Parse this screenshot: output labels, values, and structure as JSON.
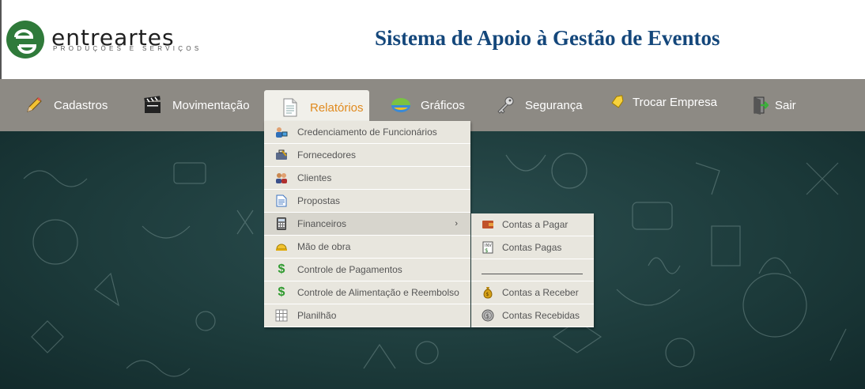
{
  "brand": {
    "name": "entreartes",
    "tagline": "PRODUÇÕES E SERVIÇOS",
    "color": "#3a7a3a"
  },
  "app_title": "Sistema de Apoio à Gestão de Eventos",
  "colors": {
    "title": "#14477b",
    "navbar": "#8d8a84",
    "active_tab_text": "#e08a1e",
    "background": "#1c3a3a"
  },
  "nav": {
    "items": [
      {
        "label": "Cadastros",
        "icon": "pencil-icon"
      },
      {
        "label": "Movimentação",
        "icon": "clapperboard-icon"
      },
      {
        "label": "Relatórios",
        "icon": "document-icon",
        "active": true
      },
      {
        "label": "Gráficos",
        "icon": "chart-icon"
      },
      {
        "label": "Segurança",
        "icon": "key-icon"
      },
      {
        "label": "Trocar Empresa",
        "icon": "tag-icon"
      },
      {
        "label": "Sair",
        "icon": "exit-door-icon"
      }
    ]
  },
  "menu": {
    "items": [
      {
        "label": "Credenciamento de Funcionários",
        "icon": "users-icon"
      },
      {
        "label": "Fornecedores",
        "icon": "briefcase-icon"
      },
      {
        "label": "Clientes",
        "icon": "people-icon"
      },
      {
        "label": "Propostas",
        "icon": "document-icon"
      },
      {
        "label": "Financeiros",
        "icon": "calculator-icon",
        "submenu_arrow": "›"
      },
      {
        "label": "Mão de obra",
        "icon": "hardhat-icon"
      },
      {
        "label": "Controle de Pagamentos",
        "icon": "dollar-icon"
      },
      {
        "label": "Controle de Alimentação e Reembolso",
        "icon": "dollar-icon"
      },
      {
        "label": "Planilhão",
        "icon": "grid-icon"
      }
    ]
  },
  "submenu": {
    "items": [
      {
        "label": "Contas a Pagar",
        "icon": "wallet-icon"
      },
      {
        "label": "Contas Pagas",
        "icon": "invoice-icon"
      },
      {
        "label": "Contas a Receber",
        "icon": "money-bag-icon"
      },
      {
        "label": "Contas Recebidas",
        "icon": "coin-icon"
      }
    ]
  }
}
